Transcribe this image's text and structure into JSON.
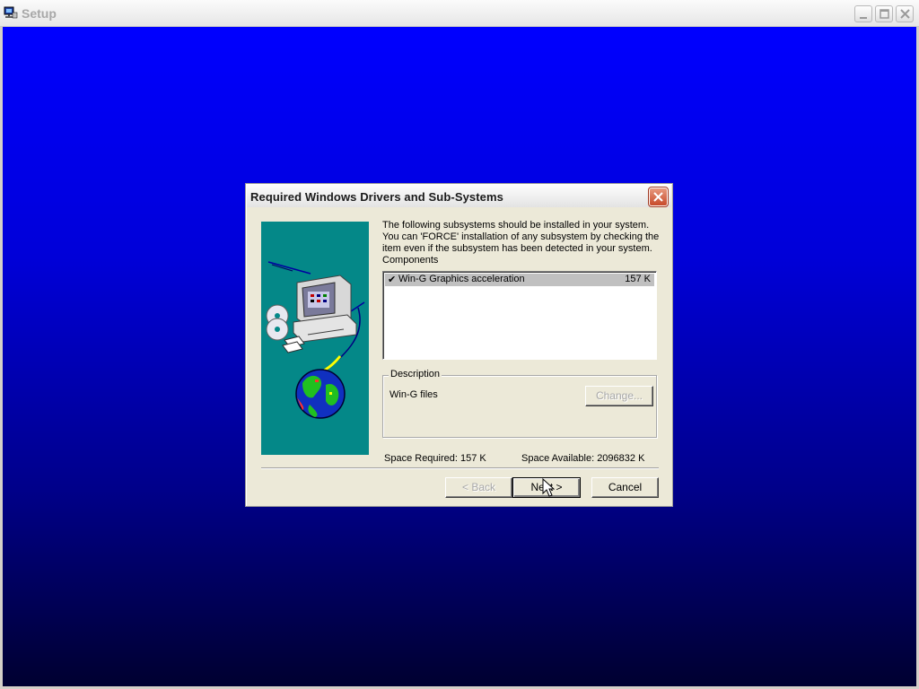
{
  "window": {
    "title": "Setup",
    "buttons": {
      "minimize": "minimize-icon",
      "maximize": "maximize-icon",
      "close": "close-icon"
    }
  },
  "dialog": {
    "title": "Required Windows Drivers and Sub-Systems",
    "info_lines": [
      "The following subsystems should be installed in your system.",
      "You can 'FORCE' installation of any subsystem by checking the",
      "item even if the subsystem has been detected in your system."
    ],
    "components_label": "Components",
    "components": [
      {
        "checked": true,
        "check_mark": "✔",
        "name": "Win-G Graphics acceleration",
        "size": "157 K"
      }
    ],
    "description": {
      "legend": "Description",
      "text": "Win-G files",
      "change_button": "Change..."
    },
    "space_required": "Space Required:  157 K",
    "space_available": "Space Available:  2096832 K",
    "buttons": {
      "back": "< Back",
      "next": "Next >",
      "cancel": "Cancel"
    }
  },
  "colors": {
    "desktop_gradient_top": "#0000ff",
    "desktop_gradient_bottom": "#000030",
    "illustration_bg": "#048888",
    "selected_row": "#c0c0c0"
  }
}
